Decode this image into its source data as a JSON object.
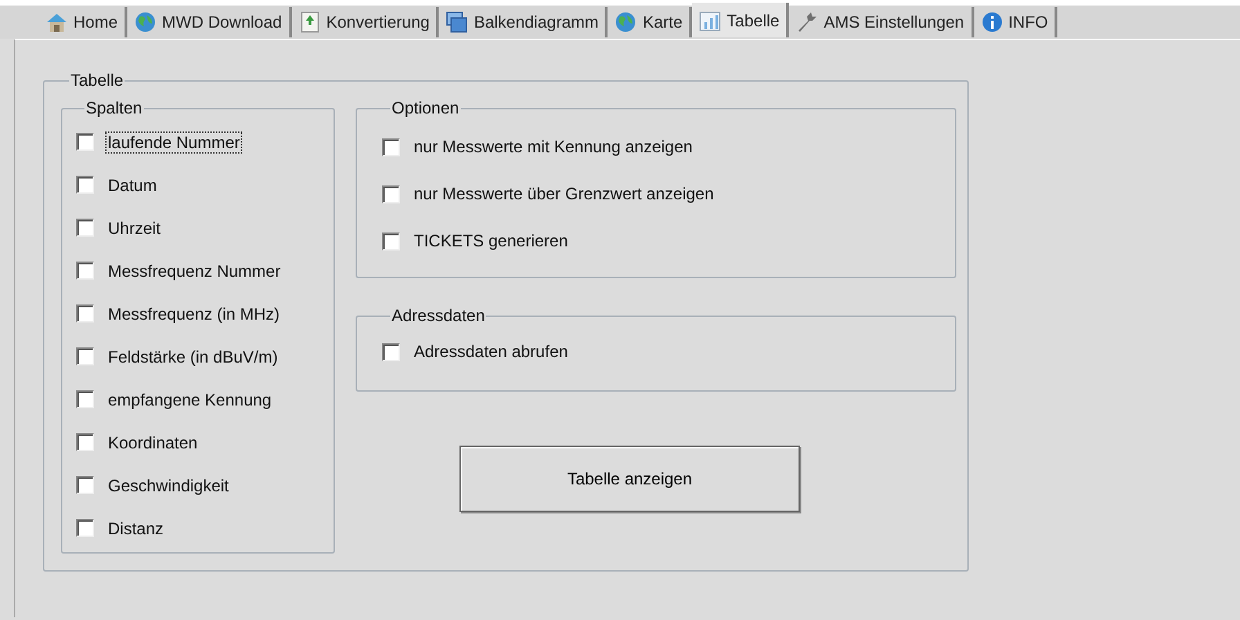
{
  "tabs": [
    {
      "label": "Home",
      "kind": "home",
      "selected": false
    },
    {
      "label": "MWD Download",
      "kind": "globe",
      "selected": false
    },
    {
      "label": "Konvertierung",
      "kind": "document",
      "selected": false
    },
    {
      "label": "Balkendiagramm",
      "kind": "windows",
      "selected": false
    },
    {
      "label": "Karte",
      "kind": "globe",
      "selected": false
    },
    {
      "label": "Tabelle",
      "kind": "table",
      "selected": true
    },
    {
      "label": "AMS Einstellungen",
      "kind": "wrench",
      "selected": false
    },
    {
      "label": "INFO",
      "kind": "info",
      "selected": false
    }
  ],
  "group": {
    "title": "Tabelle",
    "spalten": {
      "title": "Spalten",
      "items": [
        {
          "label": "laufende Nummer",
          "checked": false,
          "focused": true
        },
        {
          "label": "Datum",
          "checked": false,
          "focused": false
        },
        {
          "label": "Uhrzeit",
          "checked": false,
          "focused": false
        },
        {
          "label": "Messfrequenz Nummer",
          "checked": false,
          "focused": false
        },
        {
          "label": "Messfrequenz (in MHz)",
          "checked": false,
          "focused": false
        },
        {
          "label": "Feldstärke (in dBuV/m)",
          "checked": false,
          "focused": false
        },
        {
          "label": "empfangene Kennung",
          "checked": false,
          "focused": false
        },
        {
          "label": "Koordinaten",
          "checked": false,
          "focused": false
        },
        {
          "label": "Geschwindigkeit",
          "checked": false,
          "focused": false
        },
        {
          "label": "Distanz",
          "checked": false,
          "focused": false
        }
      ]
    },
    "optionen": {
      "title": "Optionen",
      "items": [
        {
          "label": "nur Messwerte mit Kennung anzeigen",
          "checked": false,
          "focused": false
        },
        {
          "label": "nur Messwerte über Grenzwert anzeigen",
          "checked": false,
          "focused": false
        },
        {
          "label": "TICKETS generieren",
          "checked": false,
          "focused": false
        }
      ]
    },
    "adressdaten": {
      "title": "Adressdaten",
      "items": [
        {
          "label": "Adressdaten abrufen",
          "checked": false,
          "focused": false
        }
      ]
    },
    "button": "Tabelle anzeigen"
  }
}
